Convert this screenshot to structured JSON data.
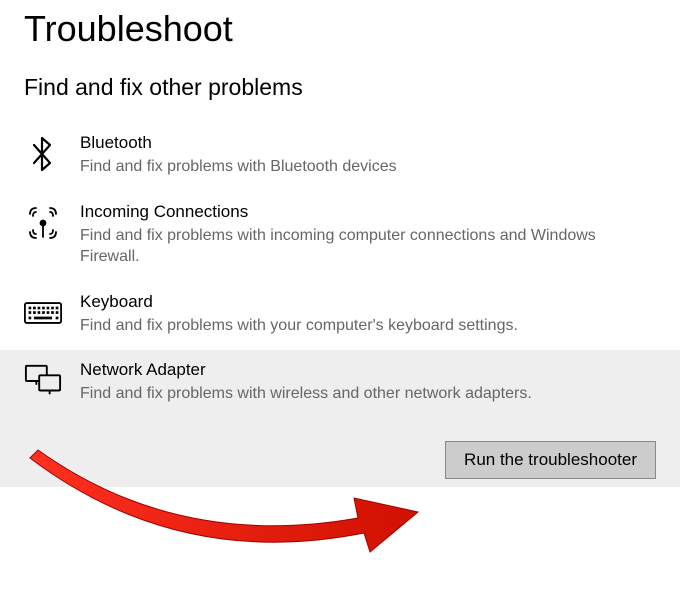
{
  "page_title": "Troubleshoot",
  "section_title": "Find and fix other problems",
  "items": [
    {
      "icon": "bluetooth",
      "title": "Bluetooth",
      "desc": "Find and fix problems with Bluetooth devices"
    },
    {
      "icon": "incoming",
      "title": "Incoming Connections",
      "desc": "Find and fix problems with incoming computer connections and Windows Firewall."
    },
    {
      "icon": "keyboard",
      "title": "Keyboard",
      "desc": "Find and fix problems with your computer's keyboard settings."
    },
    {
      "icon": "network",
      "title": "Network Adapter",
      "desc": "Find and fix problems with wireless and other network adapters."
    }
  ],
  "run_button_label": "Run the troubleshooter"
}
